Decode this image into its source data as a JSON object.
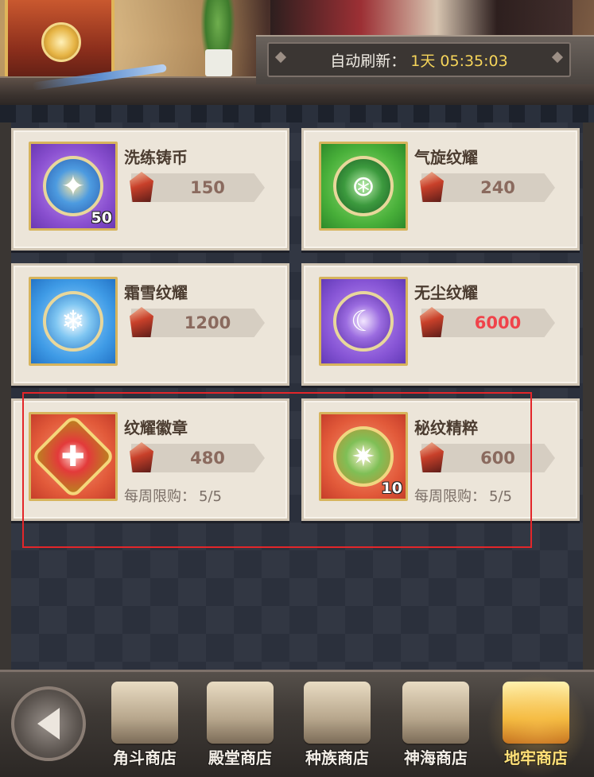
{
  "refresh": {
    "label": "自动刷新：",
    "time": "1天 05:35:03"
  },
  "items": [
    {
      "name": "洗练铸币",
      "price": "150",
      "qty": "50",
      "limit": null
    },
    {
      "name": "气旋纹耀",
      "price": "240",
      "qty": null,
      "limit": null
    },
    {
      "name": "霜雪纹耀",
      "price": "1200",
      "qty": null,
      "limit": null
    },
    {
      "name": "无尘纹耀",
      "price": "6000",
      "qty": null,
      "limit": null,
      "price_color": "#f0434a"
    },
    {
      "name": "纹耀徽章",
      "price": "480",
      "qty": null,
      "limit_label": "每周限购：",
      "limit_value": "5/5"
    },
    {
      "name": "秘纹精粹",
      "price": "600",
      "qty": "10",
      "limit_label": "每周限购：",
      "limit_value": "5/5"
    }
  ],
  "nav": {
    "tabs": [
      {
        "label": "角斗商店"
      },
      {
        "label": "殿堂商店"
      },
      {
        "label": "种族商店"
      },
      {
        "label": "神海商店"
      },
      {
        "label": "地牢商店",
        "active": true
      }
    ]
  },
  "colors": {
    "highlight": "#e3262a",
    "price_text": "#8a6a5e",
    "active_tab": "#ffe27a"
  }
}
